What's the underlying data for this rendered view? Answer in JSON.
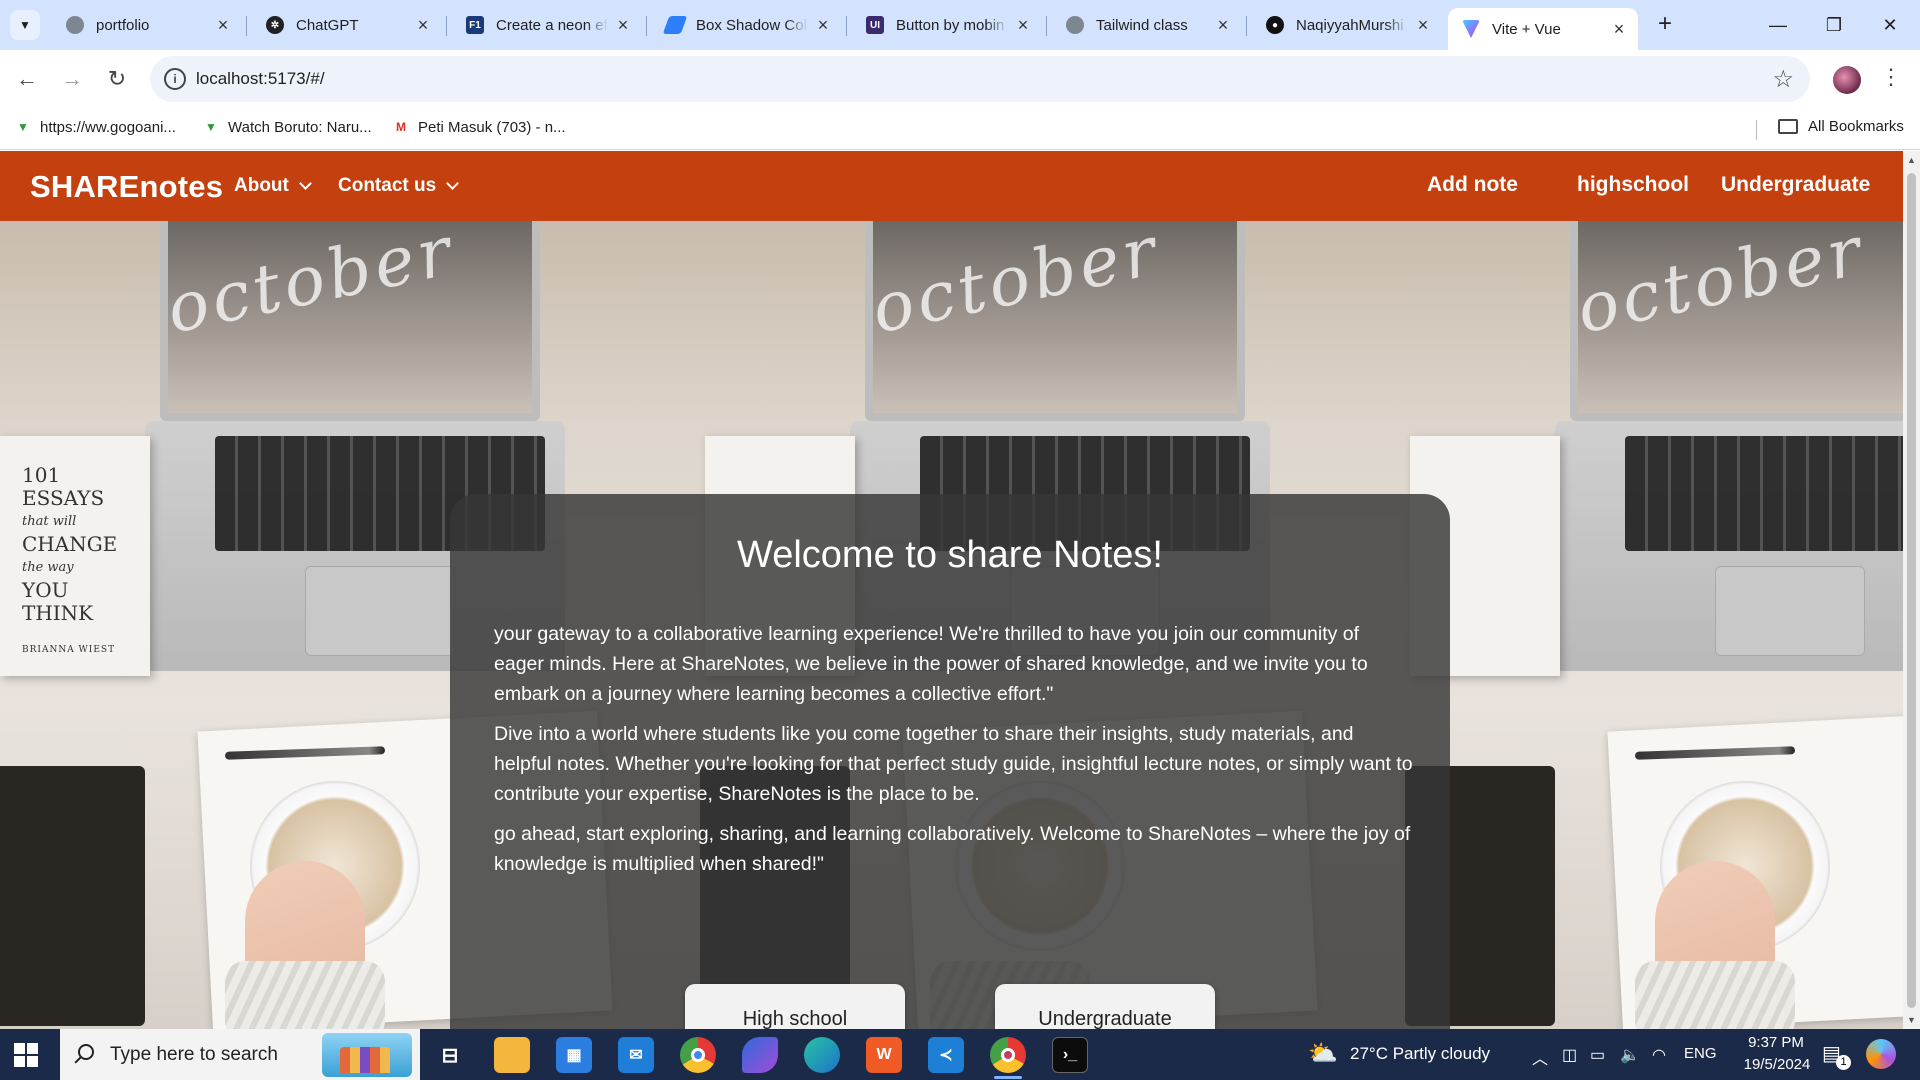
{
  "browser": {
    "tabs": [
      {
        "title": "portfolio",
        "favicon": "globe-icon",
        "color": "#5f6368"
      },
      {
        "title": "ChatGPT",
        "favicon": "chatgpt-icon",
        "color": "#202123"
      },
      {
        "title": "Create a neon eff",
        "favicon": "f1-icon",
        "color": "#1b3a7a"
      },
      {
        "title": "Box Shadow Colo",
        "favicon": "box-shadow-icon",
        "color": "#2d7ff9"
      },
      {
        "title": "Button by mobin",
        "favicon": "uiverse-icon",
        "color": "#3b2a6e"
      },
      {
        "title": "Tailwind class",
        "favicon": "globe-icon",
        "color": "#5f6368"
      },
      {
        "title": "NaqiyyahMurshi",
        "favicon": "github-icon",
        "color": "#111111"
      },
      {
        "title": "Vite + Vue",
        "favicon": "vite-icon",
        "color": "#a259ff"
      }
    ],
    "active_tab_index": 7,
    "url": "localhost:5173/#/",
    "bookmarks": [
      {
        "label": "https://ww.gogoani...",
        "icon": "gogoanime-icon",
        "color": "#2e9a3a"
      },
      {
        "label": "Watch Boruto: Naru...",
        "icon": "gogoanime-icon",
        "color": "#2e9a3a"
      },
      {
        "label": "Peti Masuk (703) - n...",
        "icon": "gmail-icon",
        "color": "#d93025"
      }
    ],
    "all_bookmarks_label": "All Bookmarks"
  },
  "app": {
    "brand": "SHAREnotes",
    "nav_color": "#c4410f",
    "dropdowns": [
      {
        "label": "About"
      },
      {
        "label": "Contact us"
      }
    ],
    "links": [
      {
        "label": "Add note"
      },
      {
        "label": "highschool"
      },
      {
        "label": "Undergraduate"
      }
    ],
    "hero": {
      "background_book_lines": [
        "101",
        "ESSAYS",
        "that will",
        "CHANGE",
        "the way",
        "YOU",
        "THINK"
      ],
      "background_author": "BRIANNA WIEST",
      "background_script": "october"
    },
    "card": {
      "title": "Welcome to share Notes!",
      "paragraphs": [
        "your gateway to a collaborative learning experience! We're thrilled to have you join our community of eager minds. Here at ShareNotes, we believe in the power of shared knowledge, and we invite you to embark on a journey where learning becomes a collective effort.\"",
        "Dive into a world where students like you come together to share their insights, study materials, and helpful notes. Whether you're looking for that perfect study guide, insightful lecture notes, or simply want to contribute your expertise, ShareNotes is the place to be.",
        "go ahead, start exploring, sharing, and learning collaboratively. Welcome to ShareNotes – where the joy of knowledge is multiplied when shared!\""
      ],
      "buttons": [
        {
          "label": "High school"
        },
        {
          "label": "Undergraduate"
        }
      ]
    }
  },
  "taskbar": {
    "search_placeholder": "Type here to search",
    "apps": [
      {
        "name": "task-view-icon"
      },
      {
        "name": "file-explorer-icon"
      },
      {
        "name": "microsoft-store-icon"
      },
      {
        "name": "mail-icon"
      },
      {
        "name": "chrome-icon"
      },
      {
        "name": "bing-copilot-icon"
      },
      {
        "name": "edge-icon"
      },
      {
        "name": "brave-icon"
      },
      {
        "name": "vscode-icon"
      },
      {
        "name": "chrome-profile-icon"
      },
      {
        "name": "terminal-icon"
      }
    ],
    "weather": "27°C  Partly cloudy",
    "language": "ENG",
    "time": "9:37 PM",
    "date": "19/5/2024",
    "notification_count": "1"
  }
}
